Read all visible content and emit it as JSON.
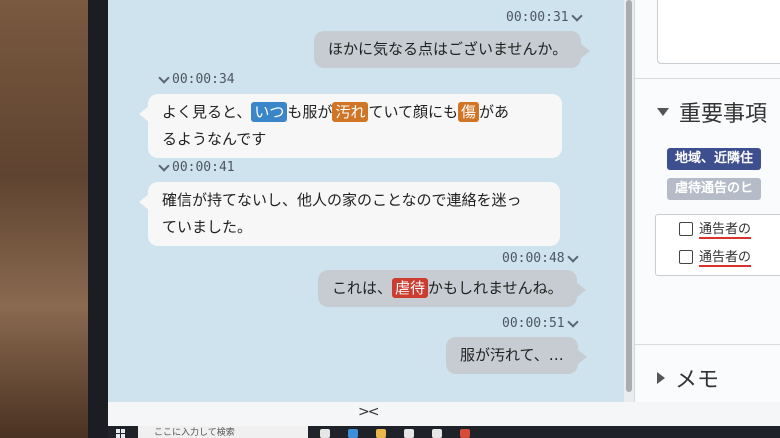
{
  "chat": {
    "messages": [
      {
        "side": "right",
        "time": "00:00:31",
        "text": "ほかに気なる点はございませんか。"
      },
      {
        "side": "left",
        "time": "00:00:34",
        "line1": {
          "a": "よく見ると、",
          "k1": "いつ",
          "b": "も服が",
          "k2": "汚れ",
          "c": "ていて顔にも",
          "k3": "傷",
          "d": "があ"
        },
        "line2": "るようなんです"
      },
      {
        "side": "left",
        "time": "00:00:41",
        "line1": "確信が持てないし、他人の家のことなので連絡を迷っ",
        "line2": "ていました。"
      },
      {
        "side": "right",
        "time": "00:00:48",
        "a": "これは、",
        "k": "虐待",
        "b": "かもしれませんね。"
      },
      {
        "side": "right",
        "time": "00:00:51",
        "text": "服が汚れて、…"
      }
    ],
    "collapse_label": "><",
    "keyword_colors": {
      "blue": "#3a86c8",
      "orange": "#d07426",
      "red": "#cc3b30"
    }
  },
  "panel": {
    "important_title": "重要事項",
    "chips": [
      {
        "text": "地域、近隣住",
        "color": "#3d4f8f"
      },
      {
        "text": "虐待通告のヒ",
        "color": "#b5bcc8"
      }
    ],
    "checklist": [
      "通告者の",
      "通告者の"
    ],
    "memo_title": "メモ"
  },
  "taskbar": {
    "search_placeholder": "ここに入力して検索"
  }
}
